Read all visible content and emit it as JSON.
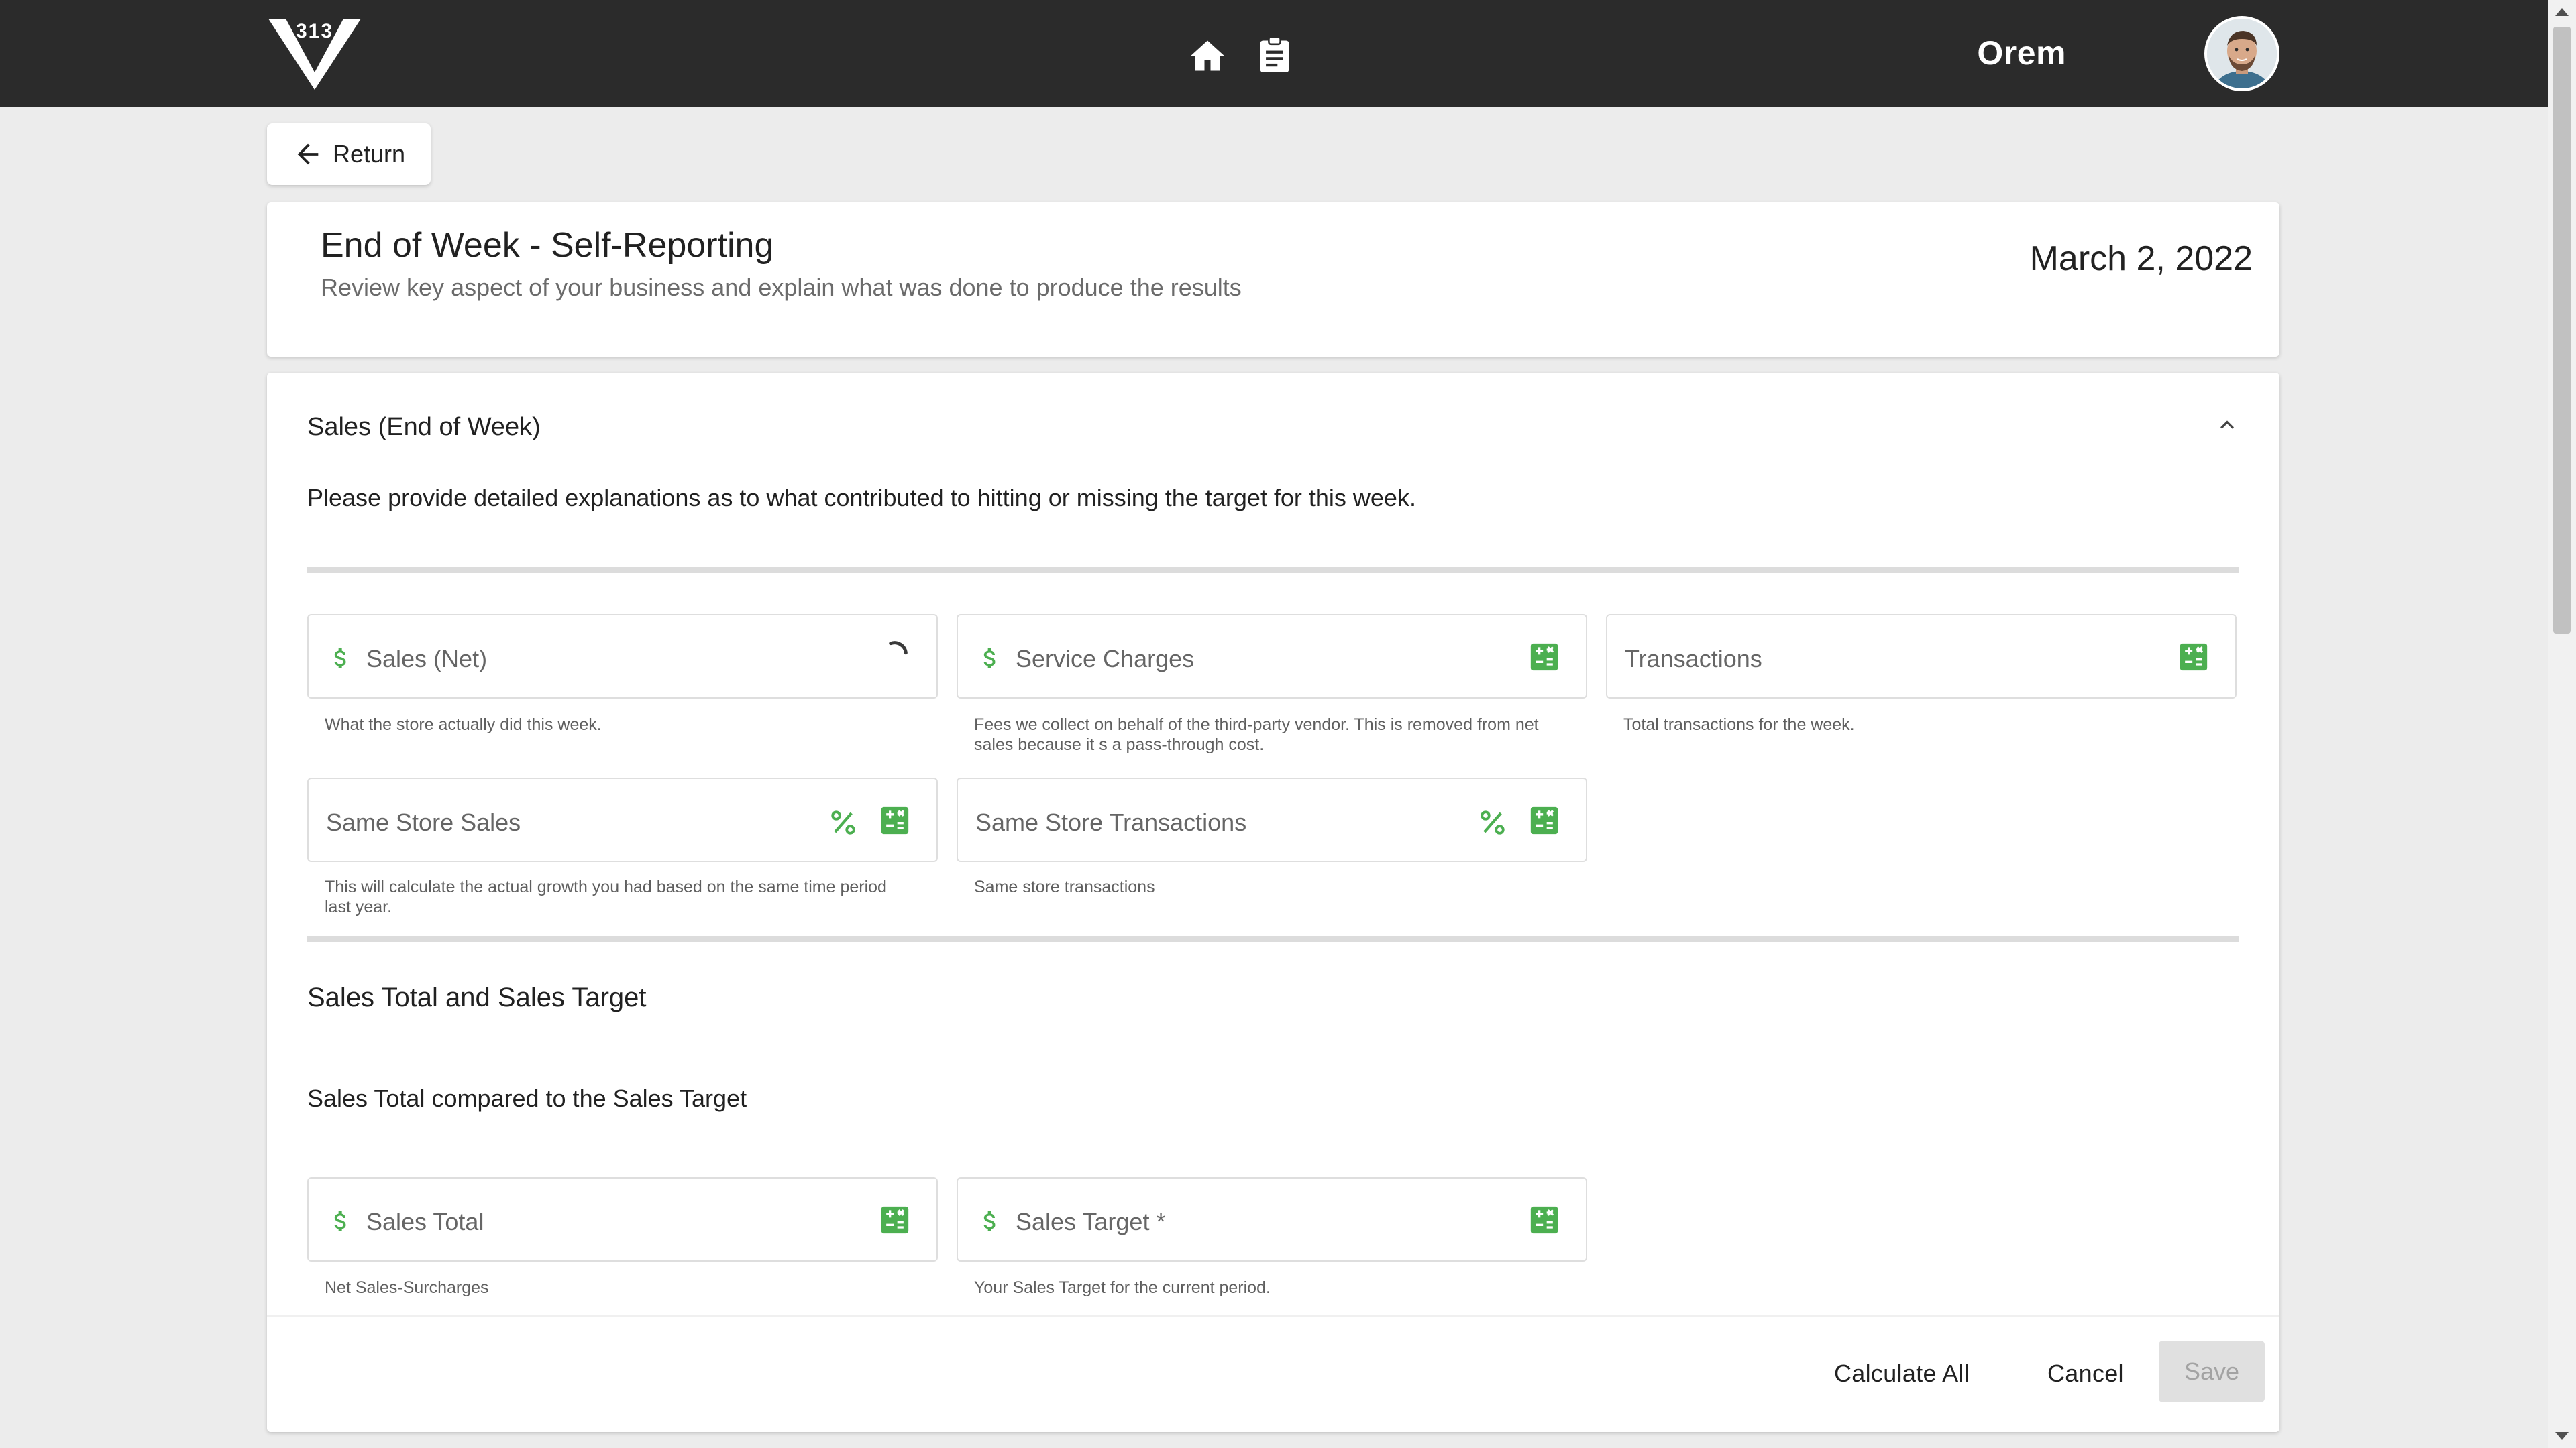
{
  "header": {
    "logo_text": "313",
    "username": "Orem"
  },
  "nav": {
    "home_icon": "home-icon",
    "reports_icon": "clipboard-icon"
  },
  "return_label": "Return",
  "page": {
    "title": "End of Week - Self-Reporting",
    "subtitle": "Review key aspect of your business and explain what was done to produce the results",
    "date": "March 2, 2022"
  },
  "section": {
    "title": "Sales (End of Week)",
    "instructions": "Please provide detailed explanations as to what contributed to hitting or missing the target for this week.",
    "fields": [
      {
        "label": "Sales (Net)",
        "help": "What the store actually did this week."
      },
      {
        "label": "Service Charges",
        "help": "Fees we collect on behalf of the third-party vendor. This is removed from net sales because it s a pass-through cost."
      },
      {
        "label": "Transactions",
        "help": "Total transactions for the week."
      },
      {
        "label": "Same Store Sales",
        "help": "This will calculate the actual growth you had based on the same time period last year."
      },
      {
        "label": "Same Store Transactions",
        "help": "Same store transactions"
      }
    ],
    "subsection": {
      "title": "Sales Total and Sales Target",
      "description": "Sales Total compared to the Sales Target",
      "fields": [
        {
          "label": "Sales Total",
          "help": "Net Sales-Surcharges"
        },
        {
          "label": "Sales Target *",
          "help": "Your Sales Target for the current period."
        }
      ]
    }
  },
  "footer": {
    "calculate_all": "Calculate All",
    "cancel": "Cancel",
    "save": "Save"
  },
  "colors": {
    "topbar": "#2b2b2b",
    "accent_green": "#4caf50",
    "background": "#ececec"
  }
}
